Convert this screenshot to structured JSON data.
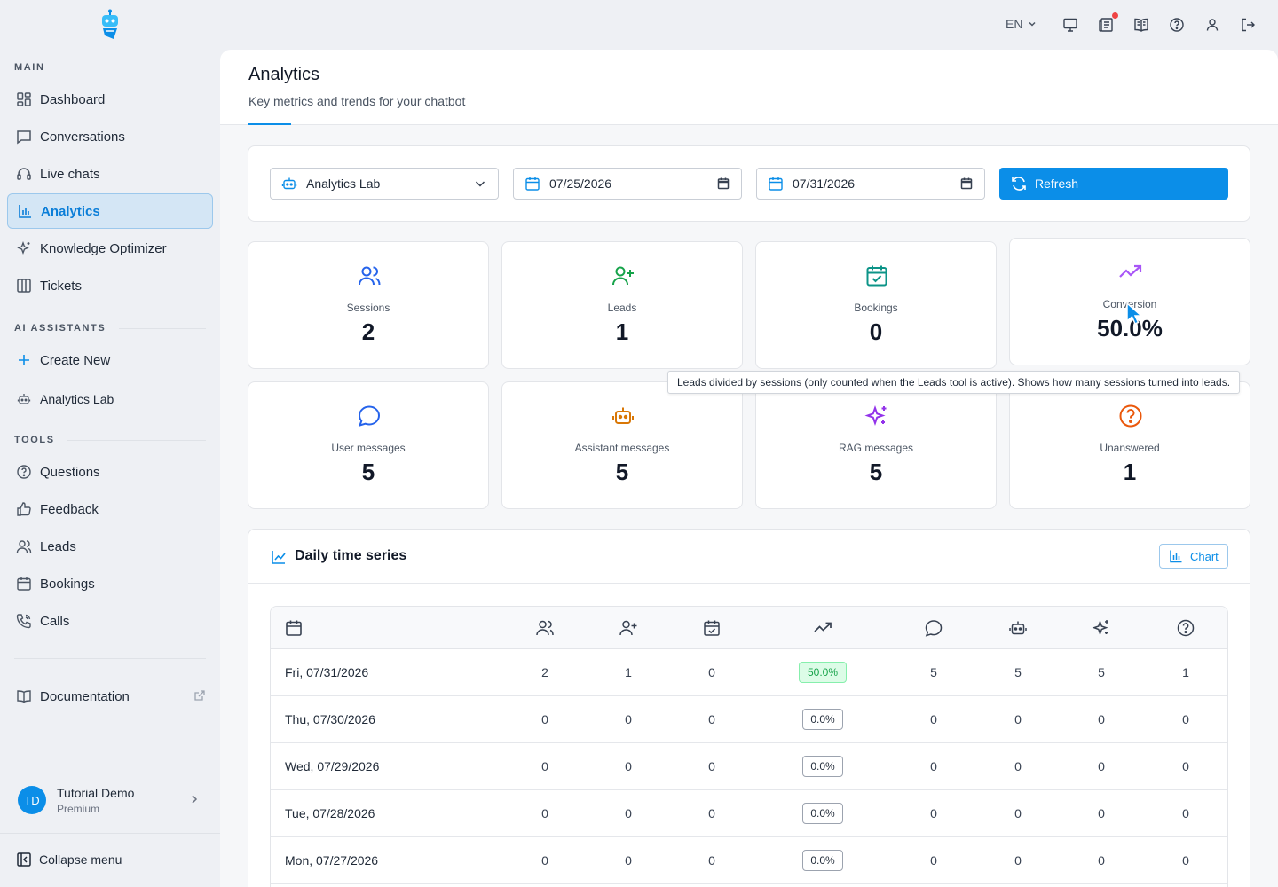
{
  "sidebar": {
    "sections": {
      "main": "MAIN",
      "ai": "AI ASSISTANTS",
      "tools": "TOOLS"
    },
    "main_items": [
      {
        "label": "Dashboard",
        "icon": "dashboard-icon"
      },
      {
        "label": "Conversations",
        "icon": "chat-icon"
      },
      {
        "label": "Live chats",
        "icon": "headset-icon"
      },
      {
        "label": "Analytics",
        "icon": "bar-chart-icon",
        "active": true
      },
      {
        "label": "Knowledge Optimizer",
        "icon": "sparkles-icon"
      },
      {
        "label": "Tickets",
        "icon": "columns-icon"
      }
    ],
    "ai_items": [
      {
        "label": "Create New",
        "icon": "plus-icon"
      },
      {
        "label": "Analytics Lab",
        "icon": "bot-icon"
      }
    ],
    "tool_items": [
      {
        "label": "Questions",
        "icon": "question-icon"
      },
      {
        "label": "Feedback",
        "icon": "thumbs-up-icon"
      },
      {
        "label": "Leads",
        "icon": "users-icon"
      },
      {
        "label": "Bookings",
        "icon": "calendar-icon"
      },
      {
        "label": "Calls",
        "icon": "phone-icon"
      }
    ],
    "documentation": "Documentation",
    "user": {
      "initials": "TD",
      "name": "Tutorial Demo",
      "plan": "Premium"
    },
    "collapse_label": "Collapse menu"
  },
  "topbar": {
    "language": "EN"
  },
  "page": {
    "title": "Analytics",
    "subtitle": "Key metrics and trends for your chatbot"
  },
  "filters": {
    "bot": "Analytics Lab",
    "date_from": "07/25/2026",
    "date_to": "07/31/2026",
    "refresh_label": "Refresh"
  },
  "metrics": [
    {
      "label": "Sessions",
      "value": "2",
      "icon": "users-icon",
      "color": "#2563eb"
    },
    {
      "label": "Leads",
      "value": "1",
      "icon": "user-plus-icon",
      "color": "#16a34a"
    },
    {
      "label": "Bookings",
      "value": "0",
      "icon": "calendar-check-icon",
      "color": "#0d9488"
    },
    {
      "label": "Conversion",
      "value": "50.0%",
      "icon": "trending-up-icon",
      "color": "#a855f7"
    },
    {
      "label": "User messages",
      "value": "5",
      "icon": "chat-bubble-icon",
      "color": "#2563eb"
    },
    {
      "label": "Assistant messages",
      "value": "5",
      "icon": "bot-icon",
      "color": "#d97706"
    },
    {
      "label": "RAG messages",
      "value": "5",
      "icon": "sparkles-icon",
      "color": "#9333ea"
    },
    {
      "label": "Unanswered",
      "value": "1",
      "icon": "question-icon",
      "color": "#ea580c"
    }
  ],
  "tooltip": "Leads divided by sessions (only counted when the Leads tool is active). Shows how many sessions turned into leads.",
  "series": {
    "title": "Daily time series",
    "chart_button": "Chart",
    "columns": [
      "calendar-icon",
      "users-icon",
      "user-plus-icon",
      "calendar-check-icon",
      "trending-up-icon",
      "chat-bubble-icon",
      "bot-icon",
      "sparkles-icon",
      "question-icon"
    ],
    "rows": [
      {
        "date": "Fri, 07/31/2026",
        "sessions": "2",
        "leads": "1",
        "bookings": "0",
        "conversion": "50.0%",
        "user": "5",
        "assistant": "5",
        "rag": "5",
        "unanswered": "1"
      },
      {
        "date": "Thu, 07/30/2026",
        "sessions": "0",
        "leads": "0",
        "bookings": "0",
        "conversion": "0.0%",
        "user": "0",
        "assistant": "0",
        "rag": "0",
        "unanswered": "0"
      },
      {
        "date": "Wed, 07/29/2026",
        "sessions": "0",
        "leads": "0",
        "bookings": "0",
        "conversion": "0.0%",
        "user": "0",
        "assistant": "0",
        "rag": "0",
        "unanswered": "0"
      },
      {
        "date": "Tue, 07/28/2026",
        "sessions": "0",
        "leads": "0",
        "bookings": "0",
        "conversion": "0.0%",
        "user": "0",
        "assistant": "0",
        "rag": "0",
        "unanswered": "0"
      },
      {
        "date": "Mon, 07/27/2026",
        "sessions": "0",
        "leads": "0",
        "bookings": "0",
        "conversion": "0.0%",
        "user": "0",
        "assistant": "0",
        "rag": "0",
        "unanswered": "0"
      }
    ]
  }
}
